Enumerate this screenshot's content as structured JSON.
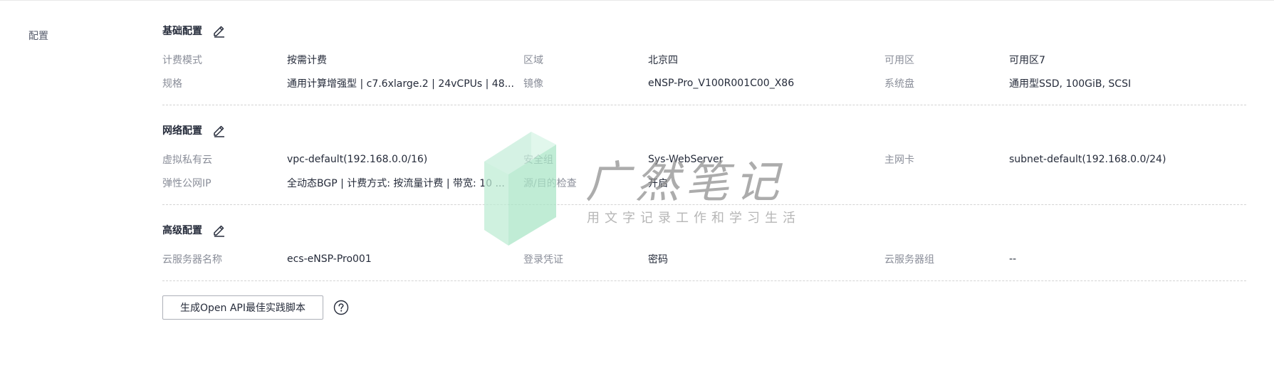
{
  "page": {
    "label": "配置"
  },
  "sections": [
    {
      "title": "基础配置",
      "rows": [
        [
          {
            "label": "计费模式",
            "value": "按需计费"
          },
          {
            "label": "区域",
            "value": "北京四"
          },
          {
            "label": "可用区",
            "value": "可用区7"
          }
        ],
        [
          {
            "label": "规格",
            "value": "通用计算增强型 | c7.6xlarge.2 | 24vCPUs | 48..."
          },
          {
            "label": "镜像",
            "value": "eNSP-Pro_V100R001C00_X86"
          },
          {
            "label": "系统盘",
            "value": "通用型SSD, 100GiB, SCSI"
          }
        ]
      ]
    },
    {
      "title": "网络配置",
      "rows": [
        [
          {
            "label": "虚拟私有云",
            "value": "vpc-default(192.168.0.0/16)"
          },
          {
            "label": "安全组",
            "value": "Sys-WebServer"
          },
          {
            "label": "主网卡",
            "value": "subnet-default(192.168.0.0/24)"
          }
        ],
        [
          {
            "label": "弹性公网IP",
            "value": "全动态BGP | 计费方式: 按流量计费 | 带宽: 10 ..."
          },
          {
            "label": "源/目的检查",
            "value": "开启"
          },
          {
            "label": "",
            "value": ""
          }
        ]
      ]
    },
    {
      "title": "高级配置",
      "rows": [
        [
          {
            "label": "云服务器名称",
            "value": "ecs-eNSP-Pro001"
          },
          {
            "label": "登录凭证",
            "value": "密码"
          },
          {
            "label": "云服务器组",
            "value": "--"
          }
        ]
      ]
    }
  ],
  "actions": {
    "api_button_label": "生成Open API最佳实践脚本"
  },
  "watermark": {
    "title": "广然笔记",
    "subtitle": "用文字记录工作和学习生活"
  },
  "icons": {
    "edit": "edit-icon",
    "help": "help-icon"
  },
  "colors": {
    "label": "#8a8e99",
    "value": "#252b3a",
    "watermark_green": "#a9e6c6"
  }
}
